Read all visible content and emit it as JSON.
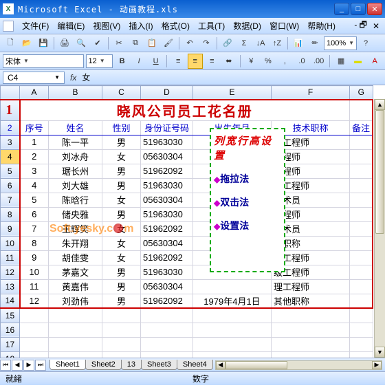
{
  "title": "Microsoft Excel - 动画教程.xls",
  "menu": [
    "文件(F)",
    "编辑(E)",
    "视图(V)",
    "插入(I)",
    "格式(O)",
    "工具(T)",
    "数据(D)",
    "窗口(W)",
    "帮助(H)"
  ],
  "zoom": "100%",
  "font_name": "宋体",
  "font_size": "12",
  "name_box": "C4",
  "fx_label": "fx",
  "formula_value": "女",
  "col_heads": [
    "",
    "A",
    "B",
    "C",
    "D",
    "E",
    "F",
    "G"
  ],
  "sheet_title": "晓风公司员工花名册",
  "headers": [
    "序号",
    "姓名",
    "性别",
    "身份证号码",
    "出生年月",
    "技术职称",
    "备注"
  ],
  "rows": [
    {
      "n": "1",
      "name": "陈一平",
      "sex": "男",
      "id": "51963030",
      "title": "级工程师"
    },
    {
      "n": "2",
      "name": "刘冰舟",
      "sex": "女",
      "id": "05630304",
      "title": "工程师"
    },
    {
      "n": "3",
      "name": "琚长州",
      "sex": "男",
      "id": "51962092",
      "title": "工程师"
    },
    {
      "n": "4",
      "name": "刘大雄",
      "sex": "男",
      "id": "51963030",
      "title": "级工程师"
    },
    {
      "n": "5",
      "name": "陈晗行",
      "sex": "女",
      "id": "05630304",
      "title": "技术员"
    },
    {
      "n": "6",
      "name": "储央雅",
      "sex": "男",
      "id": "51963030",
      "title": "工程师"
    },
    {
      "n": "7",
      "name": "王辉笑",
      "sex": "女",
      "id": "51962092",
      "title": "技术员"
    },
    {
      "n": "8",
      "name": "朱开翔",
      "sex": "女",
      "id": "05630304",
      "title": "他职称"
    },
    {
      "n": "9",
      "name": "胡佳雯",
      "sex": "女",
      "id": "51962092",
      "title": "理工程师"
    },
    {
      "n": "10",
      "name": "茅嘉文",
      "sex": "男",
      "id": "51963030",
      "title": "级工程师"
    },
    {
      "n": "11",
      "name": "黄嘉伟",
      "sex": "男",
      "id": "05630304",
      "title": "理工程师"
    },
    {
      "n": "12",
      "name": "刘劲伟",
      "sex": "男",
      "id": "51962092",
      "title": "其他职称"
    }
  ],
  "last_dob": "1979年4月1日",
  "callout": {
    "title": "列宽行高设置",
    "items": [
      "拖拉法",
      "双击法",
      "设置法"
    ]
  },
  "sheets": [
    "Sheet1",
    "Sheet2",
    "13",
    "Sheet3",
    "Sheet4"
  ],
  "status_left": "就緒",
  "status_right": "数字",
  "watermark": {
    "pre": "Soft.yesky.c",
    "post": "m"
  }
}
